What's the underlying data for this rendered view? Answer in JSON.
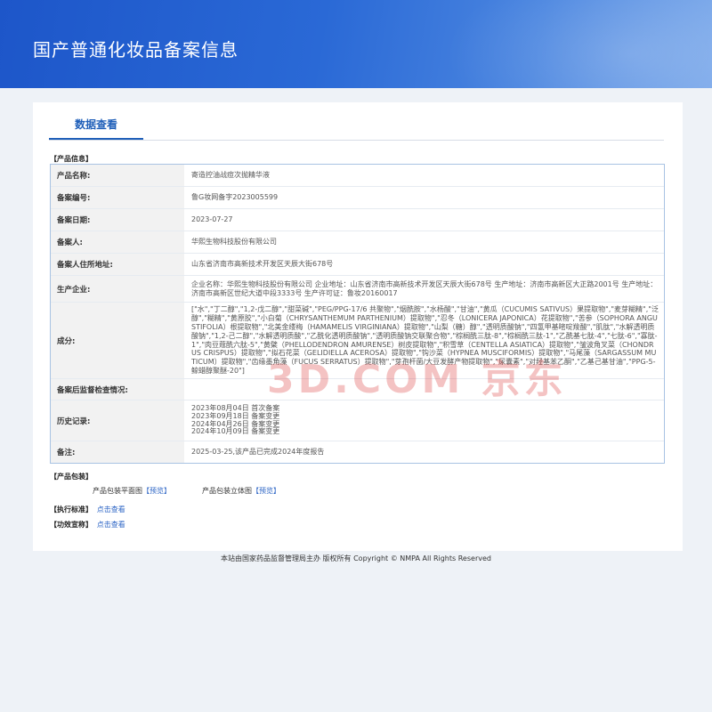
{
  "header": {
    "title": "国产普通化妆品备案信息"
  },
  "tab": {
    "label": "数据查看"
  },
  "sections": {
    "product_info": "【产品信息】",
    "packaging": "【产品包装】",
    "standard": "【执行标准】",
    "efficacy": "【功效宣称】"
  },
  "table": {
    "rows": [
      {
        "label": "产品名称:",
        "value": "寄造控油战痘次抛精华液"
      },
      {
        "label": "备案编号:",
        "value": "鲁G妆网备字2023005599"
      },
      {
        "label": "备案日期:",
        "value": "2023-07-27"
      },
      {
        "label": "备案人:",
        "value": "华熙生物科技股份有限公司"
      },
      {
        "label": "备案人住所地址:",
        "value": "山东省济南市高新技术开发区天辰大街678号"
      },
      {
        "label": "生产企业:",
        "value": "企业名称：华熙生物科技股份有限公司 企业地址：山东省济南市高新技术开发区天辰大街678号 生产地址：济南市高新区大正路2001号 生产地址：济南市高新区世纪大道中段3333号 生产许可证：鲁妆20160017"
      },
      {
        "label": "成分:",
        "value": "[\"水\",\"丁二醇\",\"1,2-戊二醇\",\"甜菜碱\",\"PEG/PPG-17/6 共聚物\",\"烟酰胺\",\"水杨酸\",\"甘油\",\"黄瓜（CUCUMIS SATIVUS）果提取物\",\"麦芽糊精\",\"泛醇\",\"糊精\",\"黄原胶\",\"小白菊（CHRYSANTHEMUM PARTHENIUM）提取物\",\"忍冬（LONICERA JAPONICA）花提取物\",\"苦参（SOPHORA ANGUSTIFOLIA）根提取物\",\"北美金缕梅（HAMAMELIS VIRGINIANA）提取物\",\"山梨（糖）醇\",\"透明质酸钠\",\"四氢甲基嘧啶羧酸\",\"肌肽\",\"水解透明质酸钠\",\"1,2-己二醇\",\"水解透明质酸\",\"乙酰化透明质酸钠\",\"透明质酸钠交联聚合物\",\"棕榈酰三肽-8\",\"棕榈酰三肽-1\",\"乙酰基七肽-4\",\"七肽-6\",\"寡肽-1\",\"肉豆蔻酰六肽-5\",\"黄檗（PHELLODENDRON AMURENSE）树皮提取物\",\"积雪草（CENTELLA ASIATICA）提取物\",\"皱波角叉菜（CHONDRUS CRISPUS）提取物\",\"拟石花菜（GELIDIELLA ACEROSA）提取物\",\"钩沙菜（HYPNEA MUSCIFORMIS）提取物\",\"马尾藻（SARGASSUM MUTICUM）提取物\",\"齿缘墨角藻（FUCUS SERRATUS）提取物\",\"芽孢杆菌/大豆发酵产物提取物\",\"尿囊素\",\"对羟基苯乙酮\",\"乙基己基甘油\",\"PPG-5-鲸蜡醇聚醚-20\"]"
      },
      {
        "label": "备案后监督检查情况:",
        "value": ""
      },
      {
        "label": "历史记录:",
        "lines": [
          "2023年08月04日 首次备案",
          "2023年09月18日 备案变更",
          "2024年04月26日 备案变更",
          "2024年10月09日 备案变更"
        ]
      },
      {
        "label": "备注:",
        "value": "2025-03-25,该产品已完成2024年度报告"
      }
    ]
  },
  "packaging": {
    "flat_label": "产品包装平面图",
    "flat_link": "【预览】",
    "stereo_label": "产品包装立体图",
    "stereo_link": "【预览】"
  },
  "standard": {
    "link": "点击查看"
  },
  "efficacy": {
    "link": "点击查看"
  },
  "watermark": "3D.COM 京东",
  "footer": "本站由国家药品监督管理局主办 版权所有 Copyright © NMPA All Rights Reserved"
}
